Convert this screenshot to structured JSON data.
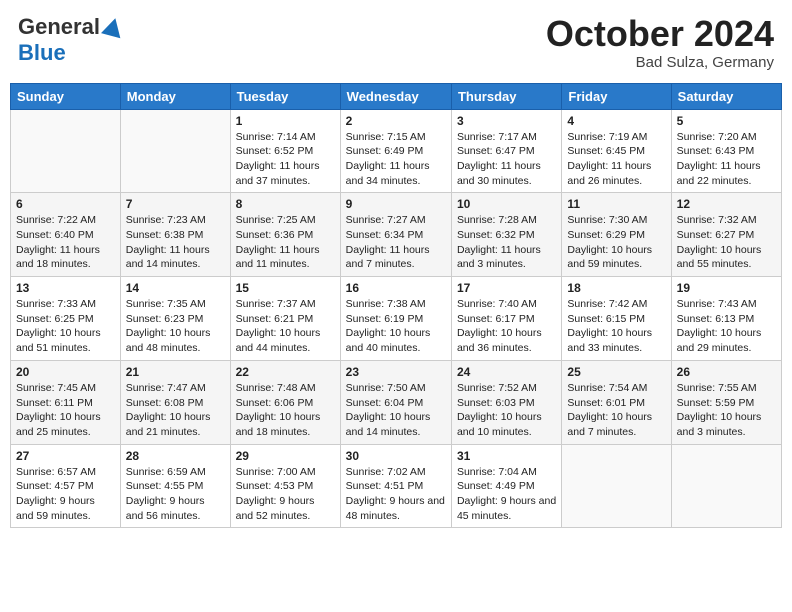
{
  "header": {
    "logo": {
      "general": "General",
      "blue": "Blue"
    },
    "month": "October 2024",
    "location": "Bad Sulza, Germany"
  },
  "weekdays": [
    "Sunday",
    "Monday",
    "Tuesday",
    "Wednesday",
    "Thursday",
    "Friday",
    "Saturday"
  ],
  "weeks": [
    [
      {
        "day": null,
        "info": null
      },
      {
        "day": null,
        "info": null
      },
      {
        "day": "1",
        "info": "Sunrise: 7:14 AM\nSunset: 6:52 PM\nDaylight: 11 hours and 37 minutes."
      },
      {
        "day": "2",
        "info": "Sunrise: 7:15 AM\nSunset: 6:49 PM\nDaylight: 11 hours and 34 minutes."
      },
      {
        "day": "3",
        "info": "Sunrise: 7:17 AM\nSunset: 6:47 PM\nDaylight: 11 hours and 30 minutes."
      },
      {
        "day": "4",
        "info": "Sunrise: 7:19 AM\nSunset: 6:45 PM\nDaylight: 11 hours and 26 minutes."
      },
      {
        "day": "5",
        "info": "Sunrise: 7:20 AM\nSunset: 6:43 PM\nDaylight: 11 hours and 22 minutes."
      }
    ],
    [
      {
        "day": "6",
        "info": "Sunrise: 7:22 AM\nSunset: 6:40 PM\nDaylight: 11 hours and 18 minutes."
      },
      {
        "day": "7",
        "info": "Sunrise: 7:23 AM\nSunset: 6:38 PM\nDaylight: 11 hours and 14 minutes."
      },
      {
        "day": "8",
        "info": "Sunrise: 7:25 AM\nSunset: 6:36 PM\nDaylight: 11 hours and 11 minutes."
      },
      {
        "day": "9",
        "info": "Sunrise: 7:27 AM\nSunset: 6:34 PM\nDaylight: 11 hours and 7 minutes."
      },
      {
        "day": "10",
        "info": "Sunrise: 7:28 AM\nSunset: 6:32 PM\nDaylight: 11 hours and 3 minutes."
      },
      {
        "day": "11",
        "info": "Sunrise: 7:30 AM\nSunset: 6:29 PM\nDaylight: 10 hours and 59 minutes."
      },
      {
        "day": "12",
        "info": "Sunrise: 7:32 AM\nSunset: 6:27 PM\nDaylight: 10 hours and 55 minutes."
      }
    ],
    [
      {
        "day": "13",
        "info": "Sunrise: 7:33 AM\nSunset: 6:25 PM\nDaylight: 10 hours and 51 minutes."
      },
      {
        "day": "14",
        "info": "Sunrise: 7:35 AM\nSunset: 6:23 PM\nDaylight: 10 hours and 48 minutes."
      },
      {
        "day": "15",
        "info": "Sunrise: 7:37 AM\nSunset: 6:21 PM\nDaylight: 10 hours and 44 minutes."
      },
      {
        "day": "16",
        "info": "Sunrise: 7:38 AM\nSunset: 6:19 PM\nDaylight: 10 hours and 40 minutes."
      },
      {
        "day": "17",
        "info": "Sunrise: 7:40 AM\nSunset: 6:17 PM\nDaylight: 10 hours and 36 minutes."
      },
      {
        "day": "18",
        "info": "Sunrise: 7:42 AM\nSunset: 6:15 PM\nDaylight: 10 hours and 33 minutes."
      },
      {
        "day": "19",
        "info": "Sunrise: 7:43 AM\nSunset: 6:13 PM\nDaylight: 10 hours and 29 minutes."
      }
    ],
    [
      {
        "day": "20",
        "info": "Sunrise: 7:45 AM\nSunset: 6:11 PM\nDaylight: 10 hours and 25 minutes."
      },
      {
        "day": "21",
        "info": "Sunrise: 7:47 AM\nSunset: 6:08 PM\nDaylight: 10 hours and 21 minutes."
      },
      {
        "day": "22",
        "info": "Sunrise: 7:48 AM\nSunset: 6:06 PM\nDaylight: 10 hours and 18 minutes."
      },
      {
        "day": "23",
        "info": "Sunrise: 7:50 AM\nSunset: 6:04 PM\nDaylight: 10 hours and 14 minutes."
      },
      {
        "day": "24",
        "info": "Sunrise: 7:52 AM\nSunset: 6:03 PM\nDaylight: 10 hours and 10 minutes."
      },
      {
        "day": "25",
        "info": "Sunrise: 7:54 AM\nSunset: 6:01 PM\nDaylight: 10 hours and 7 minutes."
      },
      {
        "day": "26",
        "info": "Sunrise: 7:55 AM\nSunset: 5:59 PM\nDaylight: 10 hours and 3 minutes."
      }
    ],
    [
      {
        "day": "27",
        "info": "Sunrise: 6:57 AM\nSunset: 4:57 PM\nDaylight: 9 hours and 59 minutes."
      },
      {
        "day": "28",
        "info": "Sunrise: 6:59 AM\nSunset: 4:55 PM\nDaylight: 9 hours and 56 minutes."
      },
      {
        "day": "29",
        "info": "Sunrise: 7:00 AM\nSunset: 4:53 PM\nDaylight: 9 hours and 52 minutes."
      },
      {
        "day": "30",
        "info": "Sunrise: 7:02 AM\nSunset: 4:51 PM\nDaylight: 9 hours and 48 minutes."
      },
      {
        "day": "31",
        "info": "Sunrise: 7:04 AM\nSunset: 4:49 PM\nDaylight: 9 hours and 45 minutes."
      },
      {
        "day": null,
        "info": null
      },
      {
        "day": null,
        "info": null
      }
    ]
  ]
}
